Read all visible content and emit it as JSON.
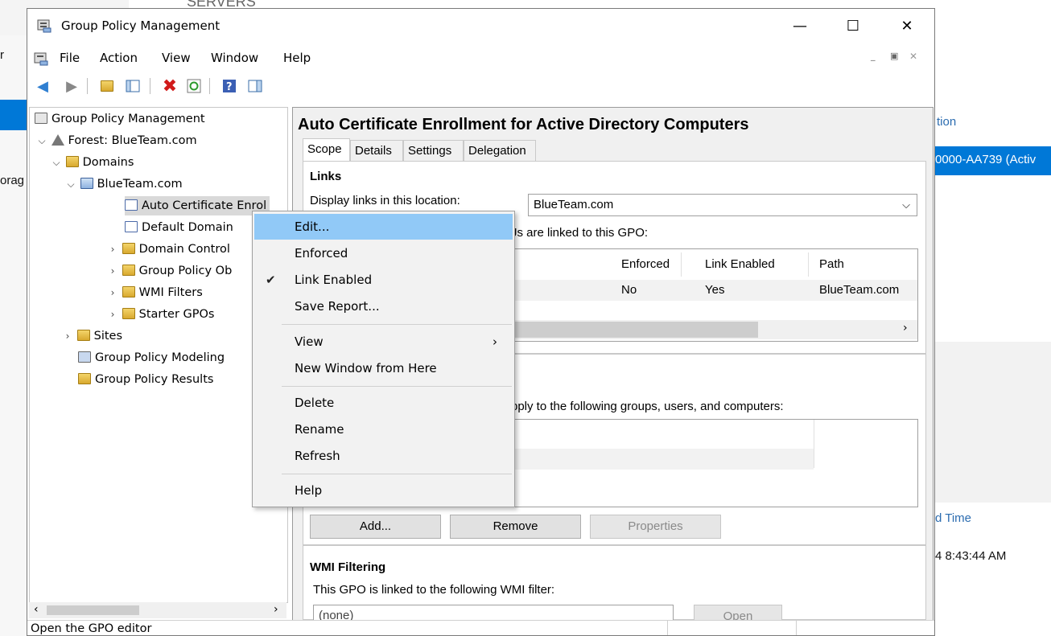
{
  "background": {
    "servers_label": "SERVERS",
    "left_frag_1": "r",
    "left_frag_2": "orag",
    "right_frag_title": "tion",
    "right_frag_server": "0000-AA739 (Activ",
    "right_frag_col": "d Time",
    "right_frag_time": "4 8:43:44 AM"
  },
  "window": {
    "title": "Group Policy Management",
    "minimize": "—",
    "maximize": "☐",
    "close": "✕"
  },
  "menubar": [
    "File",
    "Action",
    "View",
    "Window",
    "Help"
  ],
  "tree": {
    "root": "Group Policy Management",
    "forest": "Forest: BlueTeam.com",
    "domains": "Domains",
    "domain": "BlueTeam.com",
    "gpo1": "Auto Certificate Enrol",
    "gpo2": "Default Domain",
    "dc": "Domain Control",
    "gpobj": "Group Policy Ob",
    "wmi": "WMI Filters",
    "starter": "Starter GPOs",
    "sites": "Sites",
    "modeling": "Group Policy Modeling",
    "results": "Group Policy Results"
  },
  "status": "Open the GPO editor",
  "details": {
    "title": "Auto Certificate Enrollment for Active Directory Computers",
    "tabs": [
      "Scope",
      "Details",
      "Settings",
      "Delegation"
    ],
    "links_heading": "Links",
    "display_links_label": "Display links in this location:",
    "location": "BlueTeam.com",
    "linked_text": "Js are linked to this GPO:",
    "columns": [
      "Enforced",
      "Link Enabled",
      "Path"
    ],
    "row": [
      "No",
      "Yes",
      "BlueTeam.com"
    ],
    "security_text": "pply to the following groups, users, and computers:",
    "buttons": [
      "Add...",
      "Remove",
      "Properties"
    ],
    "wmi_heading": "WMI Filtering",
    "wmi_label": "This GPO is linked to the following WMI filter:",
    "wmi_value": "(none)",
    "open_button": "Open"
  },
  "context_menu": {
    "items": [
      "Edit...",
      "Enforced",
      "Link Enabled",
      "Save Report...",
      "View",
      "New Window from Here",
      "Delete",
      "Rename",
      "Refresh",
      "Help"
    ],
    "checked_item": "Link Enabled",
    "highlighted_item": "Edit..."
  },
  "colors": {
    "highlight": "#91c9f7",
    "menu_bg": "#f2f2f2",
    "selection_bg": "#0078d7"
  }
}
